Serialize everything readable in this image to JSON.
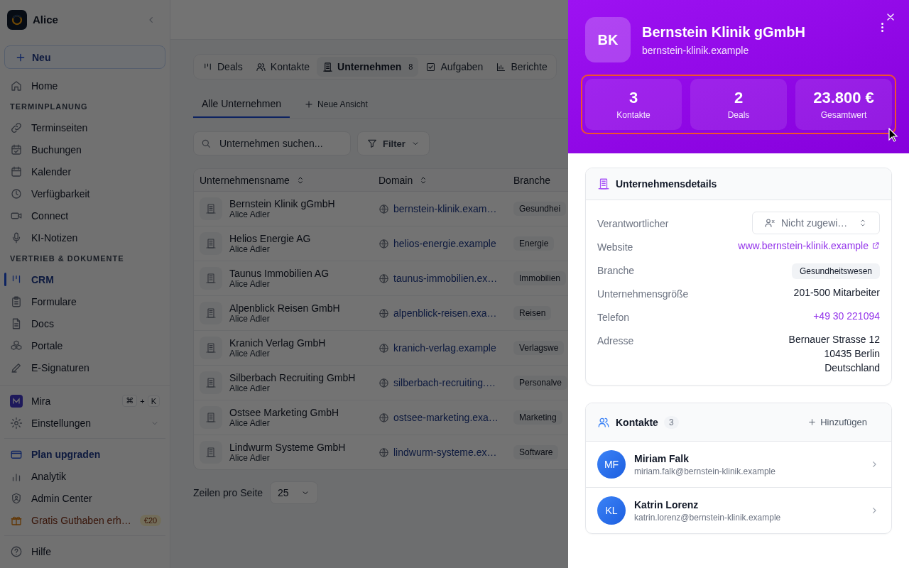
{
  "sidebar": {
    "workspace": "Alice",
    "new_button": "Neu",
    "items": [
      {
        "kind": "item",
        "label": "Home",
        "selected": false
      },
      {
        "kind": "section",
        "label": "TERMINPLANUNG"
      },
      {
        "kind": "item",
        "label": "Terminseiten",
        "selected": false
      },
      {
        "kind": "item",
        "label": "Buchungen",
        "selected": false
      },
      {
        "kind": "item",
        "label": "Kalender",
        "selected": false
      },
      {
        "kind": "item",
        "label": "Verfügbarkeit",
        "selected": false
      },
      {
        "kind": "item",
        "label": "Connect",
        "selected": false
      },
      {
        "kind": "item",
        "label": "KI-Notizen",
        "selected": false
      },
      {
        "kind": "section",
        "label": "VERTRIEB & DOKUMENTE"
      },
      {
        "kind": "item",
        "label": "CRM",
        "selected": true
      },
      {
        "kind": "item",
        "label": "Formulare",
        "selected": false
      },
      {
        "kind": "item",
        "label": "Docs",
        "selected": false
      },
      {
        "kind": "item",
        "label": "Portale",
        "selected": false
      },
      {
        "kind": "item",
        "label": "E-Signaturen",
        "selected": false
      }
    ],
    "bottom_items": [
      {
        "kind": "assistant",
        "label": "Mira",
        "keys": [
          "⌘",
          "+",
          "K"
        ]
      },
      {
        "kind": "expandable",
        "label": "Einstellungen",
        "expanded": false
      },
      {
        "kind": "divider"
      },
      {
        "kind": "accent",
        "label": "Plan upgraden"
      },
      {
        "kind": "item",
        "label": "Analytik"
      },
      {
        "kind": "item",
        "label": "Admin Center"
      },
      {
        "kind": "promo",
        "label": "Gratis Guthaben erh…",
        "badge": "€20"
      },
      {
        "kind": "divider"
      },
      {
        "kind": "item",
        "label": "Hilfe"
      }
    ]
  },
  "main": {
    "tabs": [
      {
        "label": "Deals",
        "selected": false
      },
      {
        "label": "Kontakte",
        "selected": false
      },
      {
        "label": "Unternehmen",
        "selected": true,
        "count": "8"
      },
      {
        "label": "Aufgaben",
        "selected": false
      },
      {
        "label": "Berichte",
        "selected": false
      }
    ],
    "views": [
      {
        "label": "Alle Unternehmen",
        "selected": true
      }
    ],
    "new_view": "Neue Ansicht",
    "search": {
      "placeholder": "Unternehmen suchen..."
    },
    "filter": "Filter",
    "table": {
      "columns": [
        {
          "label": "Unternehmensname",
          "sortable": true
        },
        {
          "label": "Domain",
          "sortable": true
        },
        {
          "label": "Branche",
          "sortable": false
        }
      ],
      "rows": [
        {
          "name": "Bernstein Klinik gGmbH",
          "owner": "Alice Adler",
          "domain": "bernstein-klinik.exam…",
          "industry": "Gesundhei"
        },
        {
          "name": "Helios Energie AG",
          "owner": "Alice Adler",
          "domain": "helios-energie.example",
          "industry": "Energie"
        },
        {
          "name": "Taunus Immobilien AG",
          "owner": "Alice Adler",
          "domain": "taunus-immobilien.ex…",
          "industry": "Immobilien"
        },
        {
          "name": "Alpenblick Reisen GmbH",
          "owner": "Alice Adler",
          "domain": "alpenblick-reisen.exa…",
          "industry": "Reisen"
        },
        {
          "name": "Kranich Verlag GmbH",
          "owner": "Alice Adler",
          "domain": "kranich-verlag.example",
          "industry": "Verlagswe"
        },
        {
          "name": "Silberbach Recruiting GmbH",
          "owner": "Alice Adler",
          "domain": "silberbach-recruiting.…",
          "industry": "Personalve"
        },
        {
          "name": "Ostsee Marketing GmbH",
          "owner": "Alice Adler",
          "domain": "ostsee-marketing.exa…",
          "industry": "Marketing"
        },
        {
          "name": "Lindwurm Systeme GmbH",
          "owner": "Alice Adler",
          "domain": "lindwurm-systeme.ex…",
          "industry": "Software"
        }
      ]
    },
    "rows_per_page": {
      "label": "Zeilen pro Seite",
      "value": "25"
    }
  },
  "panel": {
    "initials": "BK",
    "title": "Bernstein Klinik gGmbH",
    "domain": "bernstein-klinik.example",
    "stats": [
      {
        "value": "3",
        "label": "Kontakte"
      },
      {
        "value": "2",
        "label": "Deals"
      },
      {
        "value": "23.800 €",
        "label": "Gesamtwert"
      }
    ],
    "details": {
      "title": "Unternehmensdetails",
      "rows": [
        {
          "kind": "select",
          "label": "Verantwortlicher",
          "value": "Nicht zugewi…"
        },
        {
          "kind": "link",
          "label": "Website",
          "value": "www.bernstein-klinik.example"
        },
        {
          "kind": "tag",
          "label": "Branche",
          "value": "Gesundheitswesen"
        },
        {
          "kind": "text",
          "label": "Unternehmensgröße",
          "value": "201-500 Mitarbeiter"
        },
        {
          "kind": "phone",
          "label": "Telefon",
          "value": "+49 30 221094"
        },
        {
          "kind": "address",
          "label": "Adresse",
          "lines": [
            "Bernauer Strasse 12",
            "10435 Berlin",
            "Deutschland"
          ]
        }
      ]
    },
    "contacts": {
      "title": "Kontakte",
      "count": "3",
      "add": "Hinzufügen",
      "items": [
        {
          "initials": "MF",
          "name": "Miriam Falk",
          "email": "miriam.falk@bernstein-klinik.example"
        },
        {
          "initials": "KL",
          "name": "Katrin Lorenz",
          "email": "katrin.lorenz@bernstein-klinik.example"
        }
      ]
    }
  }
}
